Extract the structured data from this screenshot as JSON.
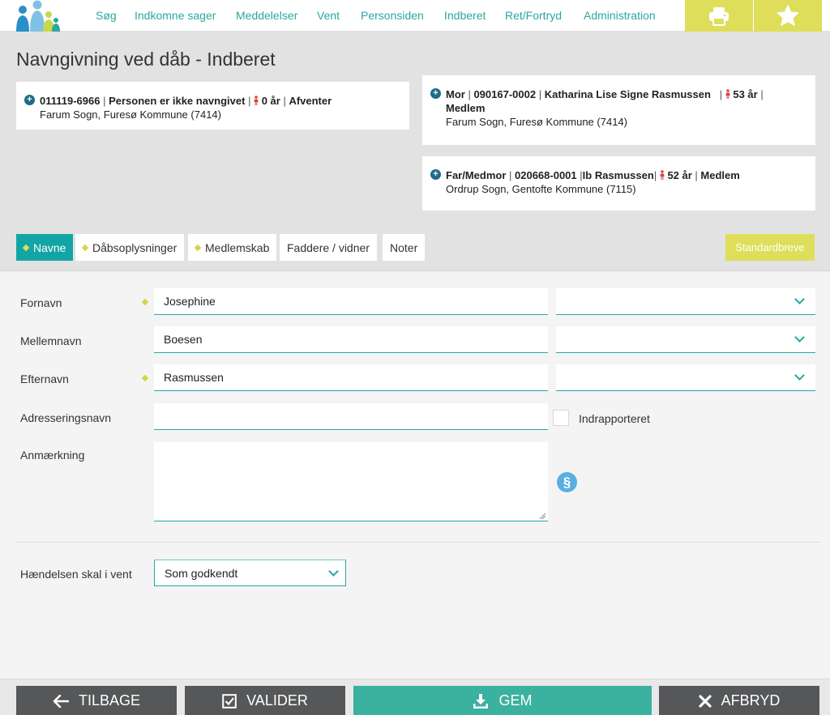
{
  "nav": {
    "items": [
      "Søg",
      "Indkomne sager",
      "Meddelelser",
      "Vent",
      "Personsiden",
      "Indberet",
      "Ret/Fortryd",
      "Administration"
    ],
    "print_icon": "printer-icon",
    "favorite_icon": "star-icon"
  },
  "page": {
    "title": "Navngivning ved dåb - Indberet"
  },
  "child": {
    "cpr": "011119-6966",
    "name_status": "Personen er ikke navngivet",
    "age": "0 år",
    "status": "Afventer",
    "parish": "Farum Sogn, Furesø Kommune (7414)"
  },
  "mother": {
    "role": "Mor",
    "cpr": "090167-0002",
    "name": "Katharina Lise Signe Rasmussen",
    "age": "53 år",
    "membership": "Medlem",
    "parish": "Farum Sogn, Furesø Kommune (7414)"
  },
  "father": {
    "role": "Far/Medmor",
    "cpr": "020668-0001",
    "name": "Ib Rasmussen",
    "age": "52 år",
    "membership": "Medlem",
    "parish": "Ordrup Sogn, Gentofte Kommune (7115)"
  },
  "tabs": [
    {
      "label": "Navne",
      "marked": true,
      "active": true
    },
    {
      "label": "Dåbsoplysninger",
      "marked": true,
      "active": false
    },
    {
      "label": "Medlemskab",
      "marked": true,
      "active": false
    },
    {
      "label": "Faddere / vidner",
      "marked": false,
      "active": false
    },
    {
      "label": "Noter",
      "marked": false,
      "active": false
    }
  ],
  "standard_letters": "Standardbreve",
  "form": {
    "first_name_label": "Fornavn",
    "first_name_value": "Josephine",
    "middle_name_label": "Mellemnavn",
    "middle_name_value": "Boesen",
    "last_name_label": "Efternavn",
    "last_name_value": "Rasmussen",
    "address_name_label": "Adresseringsnavn",
    "address_name_value": "",
    "reported_label": "Indrapporteret",
    "remark_label": "Anmærkning",
    "remark_value": "",
    "wait_label": "Hændelsen skal i vent",
    "wait_value": "Som godkendt"
  },
  "footer": {
    "back": "TILBAGE",
    "validate": "VALIDER",
    "save": "GEM",
    "cancel": "AFBRYD"
  },
  "colors": {
    "teal": "#2aa7a1",
    "active_tab": "#13a5a5",
    "yellow": "#dede5a",
    "save": "#3bb19f",
    "dark_button": "#555759"
  }
}
